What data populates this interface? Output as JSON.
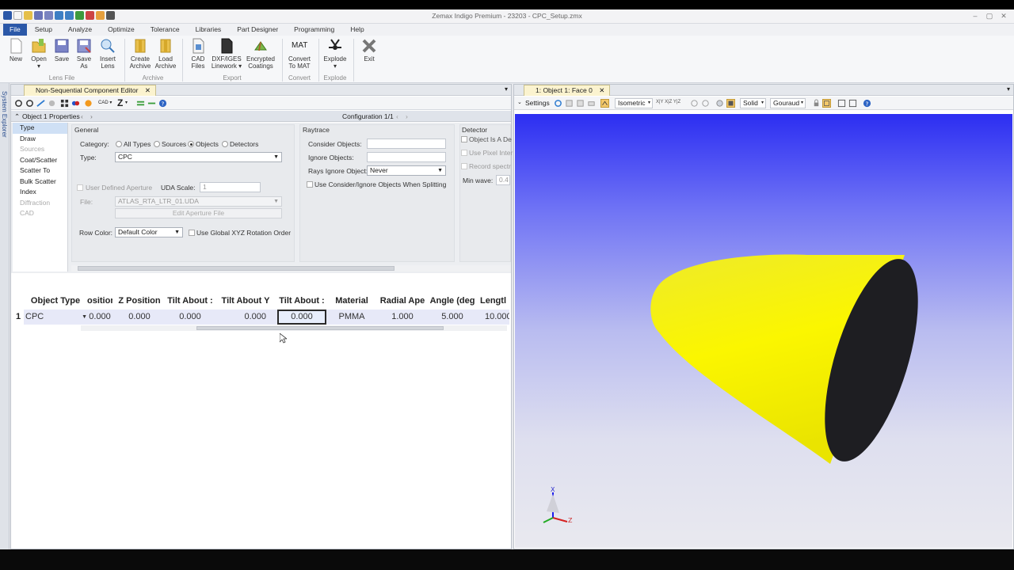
{
  "window": {
    "title": "Zemax Indigo Premium - 23203 - CPC_Setup.zmx"
  },
  "menu": [
    "File",
    "Setup",
    "Analyze",
    "Optimize",
    "Tolerance",
    "Libraries",
    "Part Designer",
    "Programming",
    "Help"
  ],
  "ribbon": {
    "buttons": [
      {
        "l1": "New",
        "l2": ""
      },
      {
        "l1": "Open",
        "l2": "▾"
      },
      {
        "l1": "Save",
        "l2": ""
      },
      {
        "l1": "Save",
        "l2": "As"
      },
      {
        "l1": "Insert",
        "l2": "Lens"
      },
      {
        "l1": "Create",
        "l2": "Archive"
      },
      {
        "l1": "Load",
        "l2": "Archive"
      },
      {
        "l1": "CAD",
        "l2": "Files"
      },
      {
        "l1": "DXF/IGES",
        "l2": "Linework ▾"
      },
      {
        "l1": "Encrypted",
        "l2": "Coatings"
      },
      {
        "l1": "Convert",
        "l2": "To MAT"
      },
      {
        "l1": "Explode",
        "l2": "▾"
      },
      {
        "l1": "Exit",
        "l2": ""
      }
    ],
    "mat_label": "MAT",
    "groups": [
      "Lens File",
      "Archive",
      "Export",
      "Convert",
      "Explode"
    ]
  },
  "system_explorer": "System Explorer",
  "nsc": {
    "tab_title": "Non-Sequential Component Editor",
    "toolbar_z": "Z",
    "toolbar_cad": "CAD",
    "properties_title": "Object 1 Properties",
    "configuration": "Configuration 1/1",
    "prop_list": [
      {
        "label": "Type",
        "state": "sel"
      },
      {
        "label": "Draw",
        "state": ""
      },
      {
        "label": "Sources",
        "state": "dis"
      },
      {
        "label": "Coat/Scatter",
        "state": ""
      },
      {
        "label": "Scatter To",
        "state": ""
      },
      {
        "label": "Bulk Scatter",
        "state": ""
      },
      {
        "label": "Index",
        "state": ""
      },
      {
        "label": "Diffraction",
        "state": "dis"
      },
      {
        "label": "CAD",
        "state": "dis"
      }
    ],
    "general": {
      "heading": "General",
      "category_label": "Category:",
      "category_options": [
        "All Types",
        "Sources",
        "Objects",
        "Detectors"
      ],
      "type_label": "Type:",
      "type_value": "CPC",
      "user_defined_aperture": "User Defined Aperture",
      "uda_scale_label": "UDA Scale:",
      "uda_scale_value": "1",
      "file_label": "File:",
      "file_value": "ATLAS_RTA_LTR_01.UDA",
      "edit_aperture_file": "Edit Aperture File",
      "row_color_label": "Row Color:",
      "row_color_value": "Default Color",
      "global_xyz": "Use Global XYZ Rotation Order"
    },
    "raytrace": {
      "heading": "Raytrace",
      "consider_objects": "Consider Objects:",
      "ignore_objects": "Ignore Objects:",
      "rays_ignore_object": "Rays Ignore Object:",
      "rays_ignore_value": "Never",
      "use_consider_ignore": "Use Consider/Ignore Objects When Splitting"
    },
    "detector": {
      "heading": "Detector",
      "object_is_a_detector": "Object Is A De",
      "use_pixel_interp": "Use Pixel Inter",
      "record_spectral": "Record spectr",
      "min_wave_label": "Min wave:",
      "min_wave_value": "0.4"
    },
    "grid": {
      "headers": [
        "Object Type",
        "osition",
        "Z Position",
        "Tilt About :",
        "Tilt About Y",
        "Tilt About :",
        "Material",
        "Radial Ape",
        "Angle (deg",
        "Lengtl"
      ],
      "rows": [
        {
          "num": "1",
          "type": "CPC",
          "cells": [
            "0.000",
            "0.000",
            "0.000",
            "0.000",
            "0.000",
            "PMMA",
            "1.000",
            "5.000",
            "10.000"
          ]
        }
      ]
    }
  },
  "viewer": {
    "tab_title": "1: Object 1: Face 0",
    "settings": "Settings",
    "view_mode": "Isometric",
    "axis_buttons": "X|Y X|Z Y|Z",
    "render_mode": "Solid",
    "shading": "Gouraud",
    "axes": [
      "X",
      "Z"
    ],
    "colors": {
      "object": "#f4ef00",
      "face": "#1e1e22"
    }
  }
}
